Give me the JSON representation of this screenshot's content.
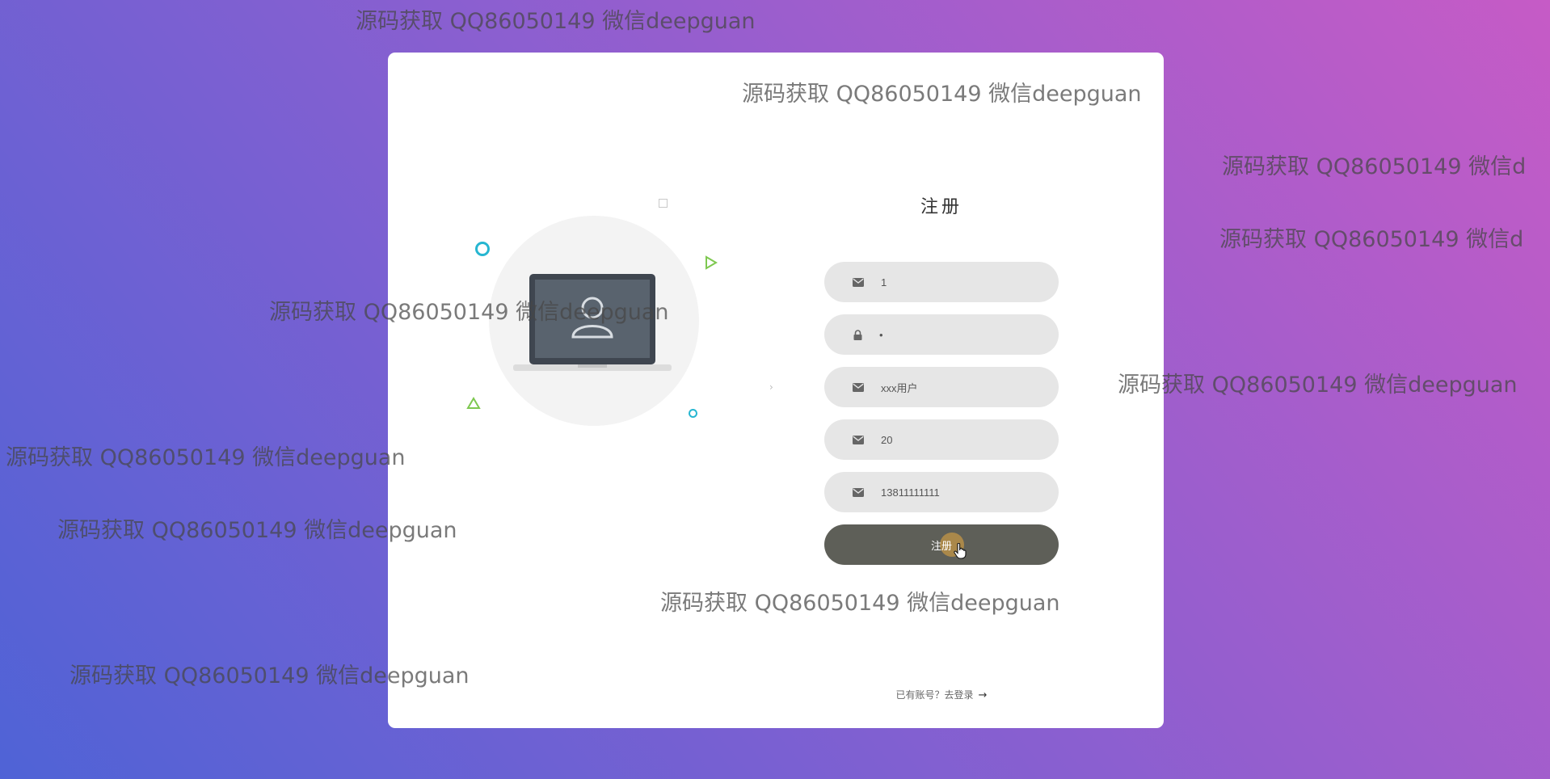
{
  "form": {
    "title": "注册",
    "fields": [
      {
        "icon": "envelope-icon",
        "value": "1"
      },
      {
        "icon": "lock-icon",
        "value": "•"
      },
      {
        "icon": "envelope-icon",
        "value": "xxx用户"
      },
      {
        "icon": "envelope-icon",
        "value": "20"
      },
      {
        "icon": "envelope-icon",
        "value": "13811111111"
      }
    ],
    "submit_label": "注册",
    "login_prompt": "已有账号？去登录",
    "login_arrow": "→"
  },
  "colors": {
    "background_start": "#4f63d6",
    "background_end": "#c65bc6",
    "card": "#ffffff",
    "field": "#e6e6e6",
    "button": "#5e5f58",
    "accent_cyan": "#26b6d1",
    "accent_green": "#7ec850"
  },
  "watermarks": [
    "源码获取 QQ86050149 微信deepguan",
    "源码获取 QQ86050149 微信deepguan",
    "源码获取 QQ86050149 微信d",
    "源码获取 QQ86050149 微信d",
    "源码获取 QQ86050149 微信deepguan",
    "源码获取 QQ86050149 微信deepguan",
    "源码获取 QQ86050149 微信deepguan",
    "源码获取 QQ86050149 微信deepguan",
    "源码获取 QQ86050149 微信deepguan",
    "源码获取 QQ86050149 微信deepguan"
  ]
}
